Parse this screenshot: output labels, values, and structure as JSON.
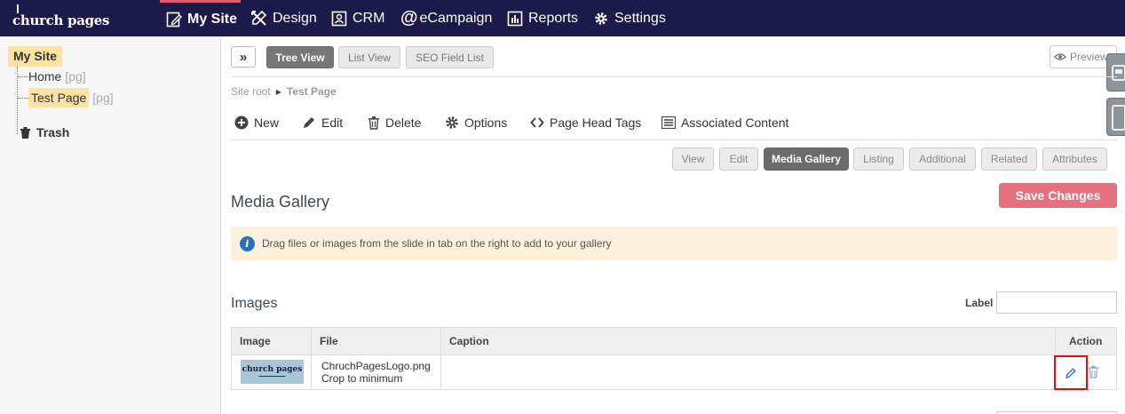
{
  "app": {
    "logo": "church pages"
  },
  "topnav": {
    "items": [
      {
        "label": "My Site",
        "icon": "edit-page-icon"
      },
      {
        "label": "Design",
        "icon": "design-tools-icon"
      },
      {
        "label": "CRM",
        "icon": "contact-card-icon"
      },
      {
        "label": "eCampaign",
        "icon": "at-sign-icon"
      },
      {
        "label": "Reports",
        "icon": "bar-chart-icon"
      },
      {
        "label": "Settings",
        "icon": "gear-icon"
      }
    ],
    "active": "My Site",
    "accent": "#e05a70",
    "background": "#1c1a4a"
  },
  "tree": {
    "root": "My Site",
    "nodes": [
      {
        "label": "Home",
        "type": "[pg]"
      },
      {
        "label": "Test Page",
        "type": "[pg]"
      }
    ],
    "trash": "Trash"
  },
  "toolbar": {
    "view_buttons": [
      "Tree View",
      "List View",
      "SEO Field List"
    ],
    "active_view": "Tree View",
    "preview": "Preview"
  },
  "breadcrumb": {
    "root": "Site root",
    "current": "Test Page"
  },
  "actions": [
    {
      "label": "New",
      "icon": "plus-circle-icon"
    },
    {
      "label": "Edit",
      "icon": "pencil-icon"
    },
    {
      "label": "Delete",
      "icon": "trash-icon"
    },
    {
      "label": "Options",
      "icon": "gear-icon"
    },
    {
      "label": "Page Head Tags",
      "icon": "code-brackets-icon"
    },
    {
      "label": "Associated Content",
      "icon": "list-icon"
    }
  ],
  "tabs": [
    "View",
    "Edit",
    "Media Gallery",
    "Listing",
    "Additional",
    "Related",
    "Attributes"
  ],
  "active_tab": "Media Gallery",
  "media_gallery": {
    "title": "Media Gallery",
    "save_label": "Save Changes",
    "save_color": "#e5707e",
    "info": "Drag files or images from the slide in tab on the right to add to your gallery",
    "images_title": "Images",
    "label_field": {
      "label": "Label",
      "value": ""
    },
    "table": {
      "headers": [
        "Image",
        "File",
        "Caption",
        "Action"
      ],
      "rows": [
        {
          "thumb_text": "church pages",
          "file": "ChruchPagesLogo.png",
          "crop": "Crop to minimum",
          "caption": ""
        }
      ]
    }
  }
}
